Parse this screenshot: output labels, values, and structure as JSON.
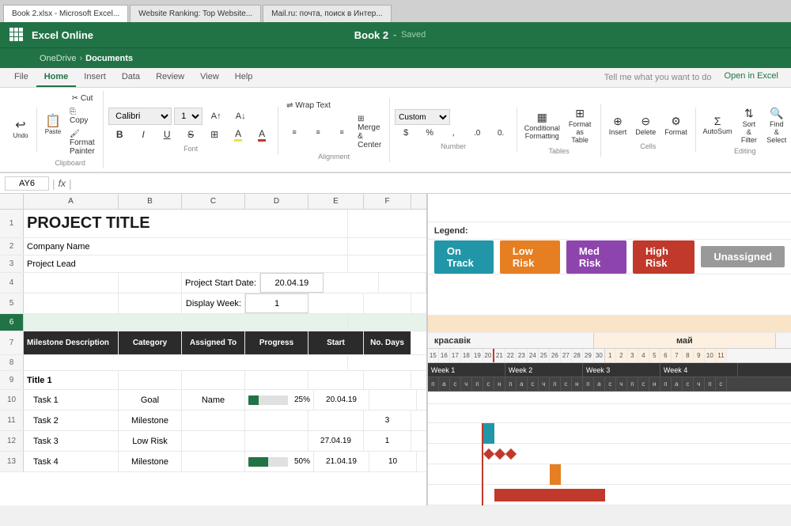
{
  "browser": {
    "tabs": [
      {
        "label": "Book 2.xlsx - Microsoft Excel...",
        "active": true
      },
      {
        "label": "Website Ranking: Top Website...",
        "active": false
      },
      {
        "label": "Mail.ru: почта, поиск в Интер...",
        "active": false
      }
    ]
  },
  "titlebar": {
    "app_name": "Excel Online",
    "book_name": "Book 2",
    "separator": "-",
    "saved_label": "Saved"
  },
  "navbar": {
    "onedrive": "OneDrive",
    "sep": "›",
    "documents": "Documents"
  },
  "ribbon_tabs": [
    {
      "label": "File",
      "active": false
    },
    {
      "label": "Home",
      "active": true
    },
    {
      "label": "Insert",
      "active": false
    },
    {
      "label": "Data",
      "active": false
    },
    {
      "label": "Review",
      "active": false
    },
    {
      "label": "View",
      "active": false
    },
    {
      "label": "Help",
      "active": false
    }
  ],
  "ribbon_tell_me": "Tell me what you want to do",
  "ribbon_open_excel": "Open in Excel",
  "formula_bar": {
    "cell_ref": "AY6",
    "fx": "fx"
  },
  "spreadsheet": {
    "title": "PROJECT TITLE",
    "company_name": "Company Name",
    "project_lead": "Project Lead",
    "project_start_label": "Project Start Date:",
    "project_start_value": "20.04.19",
    "display_week_label": "Display Week:",
    "display_week_value": "1",
    "legend_label": "Legend:",
    "legend_items": [
      {
        "label": "On Track",
        "color": "#2196a8"
      },
      {
        "label": "Low Risk",
        "color": "#e67e22"
      },
      {
        "label": "Med Risk",
        "color": "#8e44ad"
      },
      {
        "label": "High Risk",
        "color": "#c0392b"
      },
      {
        "label": "Unassigned",
        "color": "#999999"
      }
    ],
    "headers": [
      "Milestone Description",
      "Category",
      "Assigned To",
      "Progress",
      "Start",
      "No. Days"
    ],
    "rows": [
      {
        "type": "group_title",
        "label": "Title 1"
      },
      {
        "type": "task",
        "desc": "Task 1",
        "category": "Goal",
        "assigned": "Name",
        "progress": 25,
        "progress_label": "25%",
        "start": "20.04.19",
        "days": ""
      },
      {
        "type": "task",
        "desc": "Task 2",
        "category": "Milestone",
        "assigned": "",
        "progress": 0,
        "progress_label": "",
        "start": "",
        "days": "3"
      },
      {
        "type": "task",
        "desc": "Task 3",
        "category": "Low Risk",
        "assigned": "",
        "progress": 0,
        "progress_label": "",
        "start": "27.04.19",
        "days": "1"
      },
      {
        "type": "task",
        "desc": "Task 4",
        "category": "Milestone",
        "assigned": "",
        "progress": 50,
        "progress_label": "50%",
        "start": "21.04.19",
        "days": "10"
      }
    ]
  },
  "gantt": {
    "month1": "красавік",
    "month2": "май",
    "days_april": [
      "15",
      "16",
      "17",
      "18",
      "19",
      "20",
      "21",
      "22",
      "23",
      "24",
      "25",
      "26",
      "27",
      "28",
      "29",
      "30",
      "1",
      "2",
      "3",
      "4",
      "5"
    ],
    "days_may": [
      "6",
      "7",
      "8",
      "9",
      "10",
      "11"
    ],
    "weeks": [
      {
        "label": "Week 1",
        "span": 7
      },
      {
        "label": "Week 2",
        "span": 7
      },
      {
        "label": "Week 3",
        "span": 7
      },
      {
        "label": "Week 4",
        "span": 7
      }
    ],
    "daynames_pattern": [
      "п",
      "а",
      "с",
      "ч",
      "п",
      "с",
      "н"
    ]
  },
  "col_widths": {
    "row_num": 30,
    "A": 120,
    "B": 80,
    "C": 80,
    "D": 80,
    "E": 70,
    "F": 60,
    "gantt_day": 14
  }
}
